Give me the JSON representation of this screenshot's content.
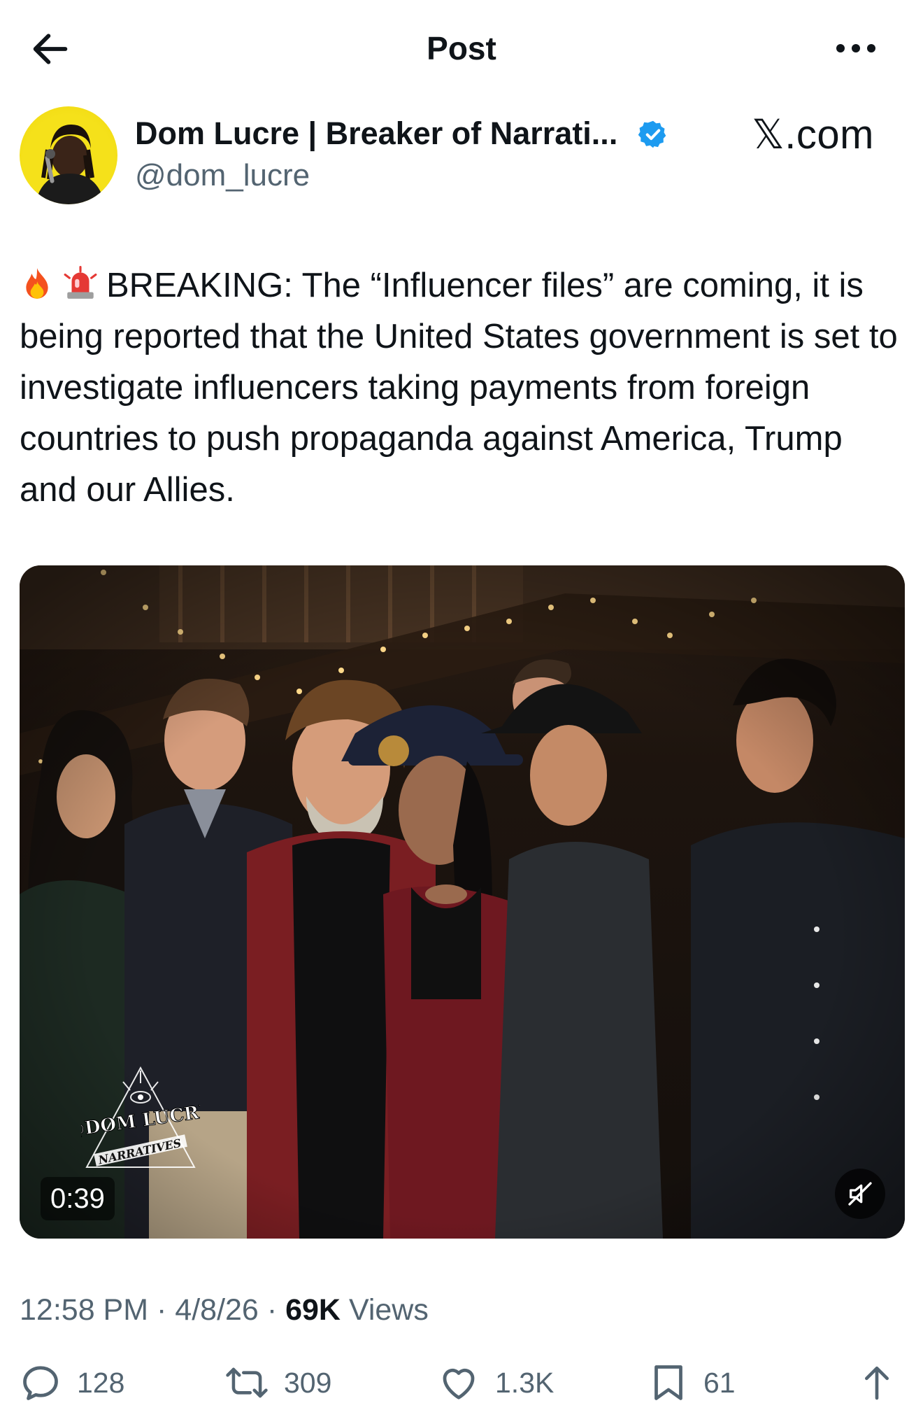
{
  "header": {
    "title": "Post",
    "back_icon": "arrow-left-icon",
    "more_icon": "more-horizontal-icon"
  },
  "author": {
    "display_name": "Dom Lucre | Breaker of Narrati...",
    "handle": "@dom_lucre",
    "verified": true,
    "verified_color": "#1d9bf0",
    "avatar_bg": "#f5e11a"
  },
  "watermark_source": "𝕏.com",
  "post": {
    "emojis": [
      "fire-emoji",
      "police-light-emoji"
    ],
    "text": "BREAKING: The “Influencer files” are coming, it is being reported that the United States government is set to investigate influencers taking payments from foreign countries to push propaganda against America, Trump and our Allies."
  },
  "media": {
    "type": "video",
    "duration": "0:39",
    "muted": true,
    "watermark_line1": "@DOM LUCRE",
    "watermark_line2": "NARRATIVES"
  },
  "meta": {
    "time": "12:58 PM",
    "separator": "·",
    "date": "4/8/26",
    "views_count": "69K",
    "views_label": "Views"
  },
  "actions": {
    "replies": "128",
    "reposts": "309",
    "likes": "1.3K",
    "bookmarks": "61"
  }
}
